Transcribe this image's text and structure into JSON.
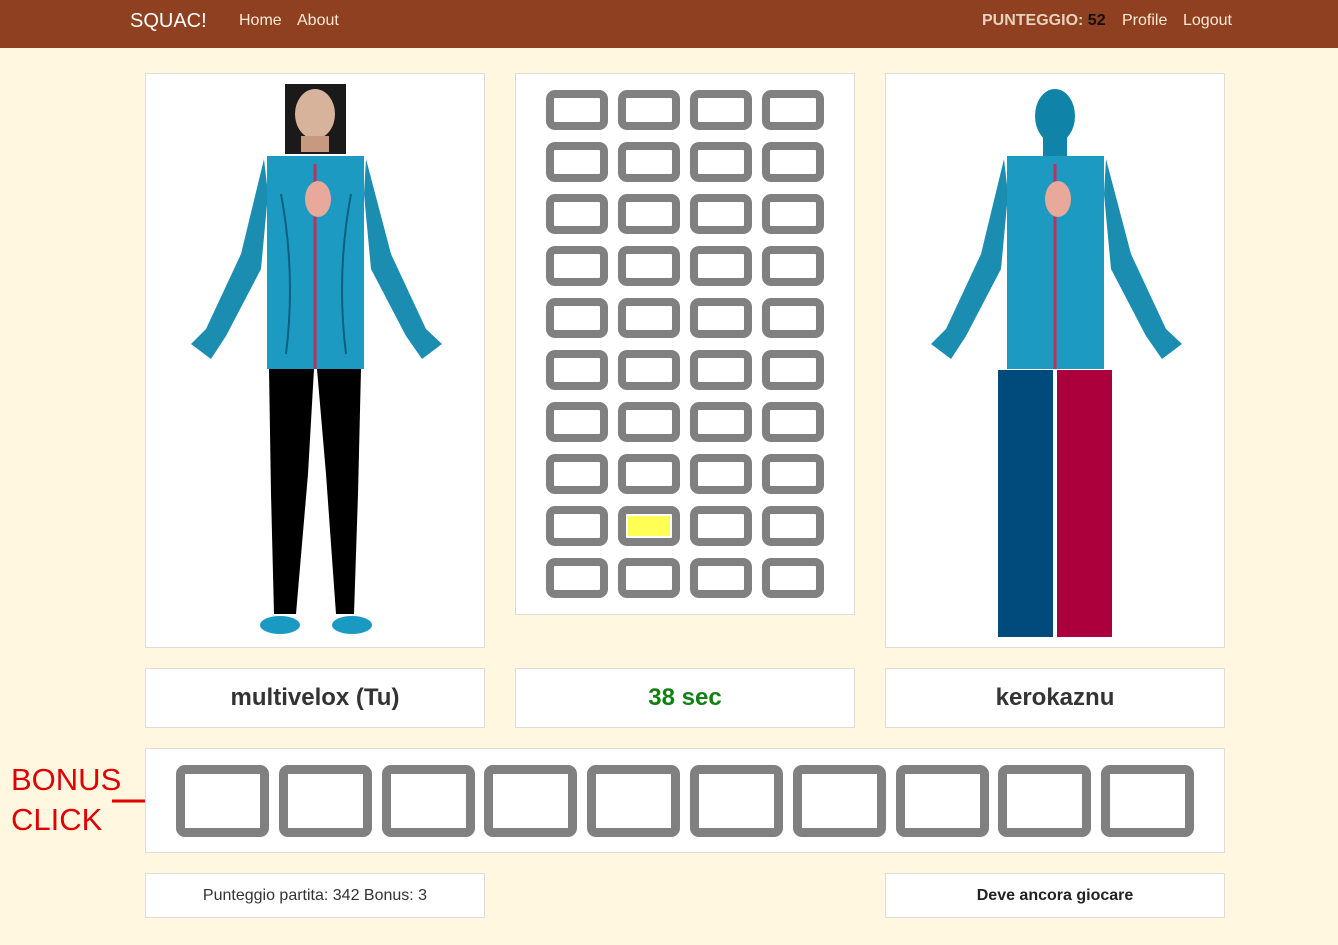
{
  "nav": {
    "brand": "SQUAC!",
    "home": "Home",
    "about": "About",
    "score_label": "PUNTEGGIO:",
    "score_value": "52",
    "profile": "Profile",
    "logout": "Logout"
  },
  "players": {
    "left_name": "multivelox (Tu)",
    "timer": "38 sec",
    "right_name": "kerokaznu"
  },
  "grid": {
    "rows": 10,
    "cols": 4,
    "active_row": 8,
    "active_col": 1
  },
  "bonus": {
    "line1": "BONUS",
    "line2": "CLICK",
    "slots": 10
  },
  "footer": {
    "left": "Punteggio partita: 342 Bonus: 3",
    "right": "Deve ancora giocare"
  },
  "colors": {
    "navbar": "#8e4020",
    "background": "#fff7e0",
    "cell_border": "#808080",
    "active_cell": "#ffff55",
    "timer": "#128012",
    "bonus_annotation": "#e00000",
    "opponent_leg_left": "#004a7c",
    "opponent_leg_right": "#ab003b"
  }
}
